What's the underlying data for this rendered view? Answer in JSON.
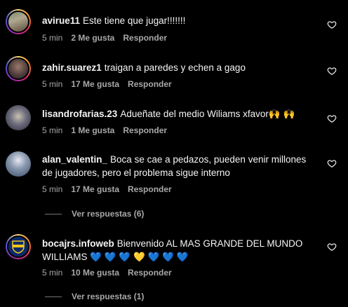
{
  "comments": [
    {
      "username": "avirue11",
      "text": "Este tiene que jugar!!!!!!!",
      "time": "5 min",
      "likes": "2 Me gusta",
      "reply": "Responder"
    },
    {
      "username": "zahir.suarez1",
      "text": "traigan a paredes y echen a gago",
      "time": "5 min",
      "likes": "17 Me gusta",
      "reply": "Responder"
    },
    {
      "username": "lisandrofarias.23",
      "text": "Adueñate del medio Wiliams xfavor🙌 🙌",
      "time": "5 min",
      "likes": "1 Me gusta",
      "reply": "Responder"
    },
    {
      "username": "alan_valentin_",
      "text": "Boca se cae a pedazos, pueden venir millones de jugadores, pero el problema sigue interno",
      "time": "5 min",
      "likes": "17 Me gusta",
      "reply": "Responder",
      "view_replies": "Ver respuestas (6)"
    },
    {
      "username": "bocajrs.infoweb",
      "text": "Bienvenido AL MAS GRANDE DEL MUNDO WILLIAMS 💙 💙 💙 💛 💙 💙 💙",
      "time": "5 min",
      "likes": "10 Me gusta",
      "reply": "Responder",
      "view_replies": "Ver respuestas (1)"
    }
  ],
  "colors": {
    "background": "#000000",
    "text": "#f5f5f5",
    "muted": "#a8a8a8",
    "heart_stroke": "#f5f5f5"
  },
  "icons": {
    "like": "heart-outline-icon"
  }
}
